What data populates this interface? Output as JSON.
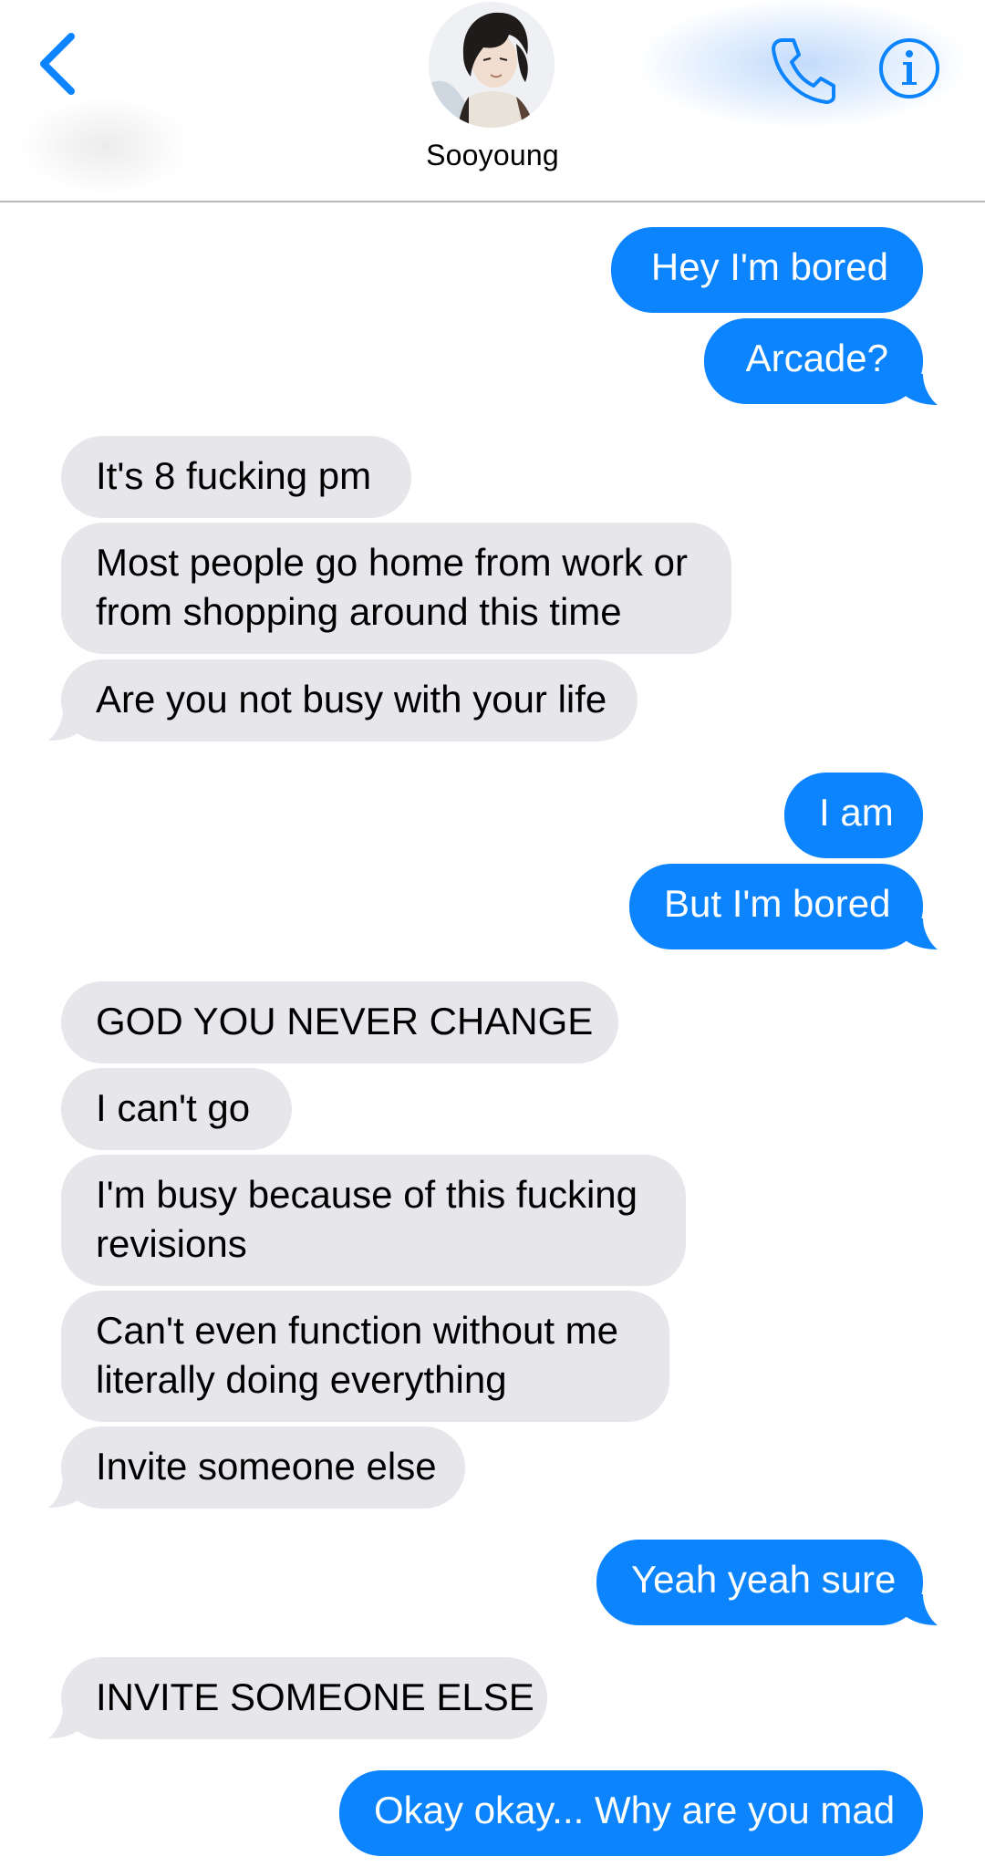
{
  "header": {
    "contact_name": "Sooyoung",
    "back_icon": "chevron-left-icon",
    "call_icon": "phone-icon",
    "info_icon": "info-icon",
    "accent_color": "#0b84fe"
  },
  "messages": [
    {
      "from": "me",
      "text": "Hey I'm bored"
    },
    {
      "from": "me",
      "text": "Arcade?"
    },
    {
      "from": "them",
      "text": "It's 8 fucking pm"
    },
    {
      "from": "them",
      "line1": "Most people go home from work or",
      "line2": "from shopping around this time"
    },
    {
      "from": "them",
      "text": "Are you not busy with your life"
    },
    {
      "from": "me",
      "text": "I am"
    },
    {
      "from": "me",
      "text": "But I'm bored"
    },
    {
      "from": "them",
      "text": "GOD YOU NEVER CHANGE"
    },
    {
      "from": "them",
      "text": "I can't go"
    },
    {
      "from": "them",
      "line1": "I'm busy because of this fucking",
      "line2": "revisions"
    },
    {
      "from": "them",
      "line1": "Can't even function without me",
      "line2": "literally doing everything"
    },
    {
      "from": "them",
      "text": "Invite someone else"
    },
    {
      "from": "me",
      "text": "Yeah yeah sure"
    },
    {
      "from": "them",
      "text": "INVITE SOMEONE ELSE"
    },
    {
      "from": "me",
      "text": "Okay okay... Why are you mad"
    }
  ],
  "colors": {
    "incoming_bubble": "#e6e6eb",
    "outgoing_bubble": "#0b84fe"
  }
}
